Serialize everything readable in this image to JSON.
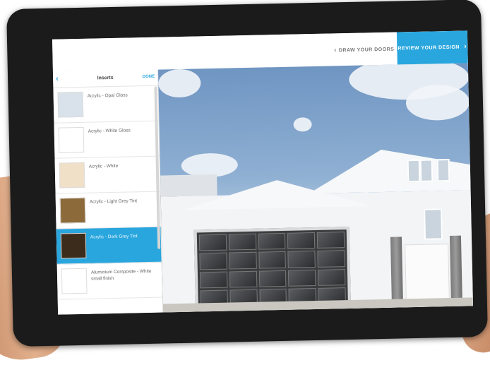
{
  "header": {
    "back_label": "DRAW YOUR DOORS",
    "next_label": "REVIEW YOUR DESIGN"
  },
  "sidebar": {
    "title": "Inserts",
    "done_label": "DONE",
    "items": [
      {
        "label": "Acrylic - Opal Gloss",
        "swatch": "#d9e2ea",
        "selected": false
      },
      {
        "label": "Acrylic - White Gloss",
        "swatch": "#ffffff",
        "selected": false
      },
      {
        "label": "Acrylic - White",
        "swatch": "#f0e0c8",
        "selected": false
      },
      {
        "label": "Acrylic - Light Grey Tint",
        "swatch": "#8c6a3a",
        "selected": false
      },
      {
        "label": "Acrylic - Dark Grey Tint",
        "swatch": "#3b2c1c",
        "selected": true
      },
      {
        "label": "Aluminium Composite - White small finish",
        "swatch": "#ffffff",
        "selected": false
      }
    ]
  },
  "colors": {
    "accent": "#2aa6de",
    "tablet_frame": "#1b1b1b"
  },
  "icons": {
    "back": "chevron-left-icon",
    "next": "chevron-right-icon"
  }
}
